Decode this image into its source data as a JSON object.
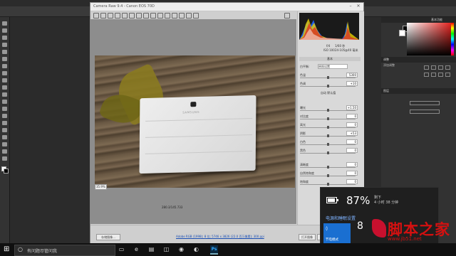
{
  "photoshop": {
    "panel_tabs": {
      "right_top": "基本功能",
      "adjust": "调整",
      "adjust_sub": "添加调整",
      "layers": "图层"
    },
    "colors": {
      "accent_red": "#e52420",
      "bg": "#2b2b2b"
    }
  },
  "camera_raw": {
    "title": "Camera Raw 9.4  -  Canon EOS 70D",
    "image_brand": "SAMSUNG",
    "zoom": "35.9%",
    "pixel_info": "280.3/145.733",
    "workflow_link": "Adobe RGB (1998); 8 位; 5746 x 3826 (22.0 百万像素); 300 ppi",
    "buttons": {
      "save": "存储图像...",
      "open": "打开图像",
      "cancel": "取消",
      "done": "完成"
    },
    "histogram_readout": {
      "aperture": "f/4",
      "shutter": "1/60 秒",
      "iso": "ISO 100",
      "lens": "24-105@40 毫米"
    },
    "panel": {
      "section": "基本",
      "wb_label": "白平衡:",
      "wb_value": "原照设置",
      "auto_default": "自动  默认值",
      "sliders": [
        {
          "label": "色温",
          "value": "5300"
        },
        {
          "label": "色调",
          "value": "+10"
        },
        {
          "label": "曝光",
          "value": "+1.50"
        },
        {
          "label": "对比度",
          "value": "0"
        },
        {
          "label": "高光",
          "value": "0"
        },
        {
          "label": "阴影",
          "value": "+53"
        },
        {
          "label": "白色",
          "value": "0"
        },
        {
          "label": "黑色",
          "value": "0"
        },
        {
          "label": "清晰度",
          "value": "0"
        },
        {
          "label": "自然饱和度",
          "value": "0"
        },
        {
          "label": "饱和度",
          "value": "0"
        }
      ]
    }
  },
  "battery": {
    "percent": "87%",
    "remaining_label": "剩下",
    "remaining_time": "4 小时 38 分钟",
    "level": 0.87,
    "settings_link": "电源和睡眠设置",
    "saver_tile": "节电模式",
    "slider_value": "8"
  },
  "taskbar": {
    "search_placeholder": "有问题尽管问我"
  },
  "watermark": {
    "text": "脚本之家",
    "url": "www.jb51.net"
  }
}
